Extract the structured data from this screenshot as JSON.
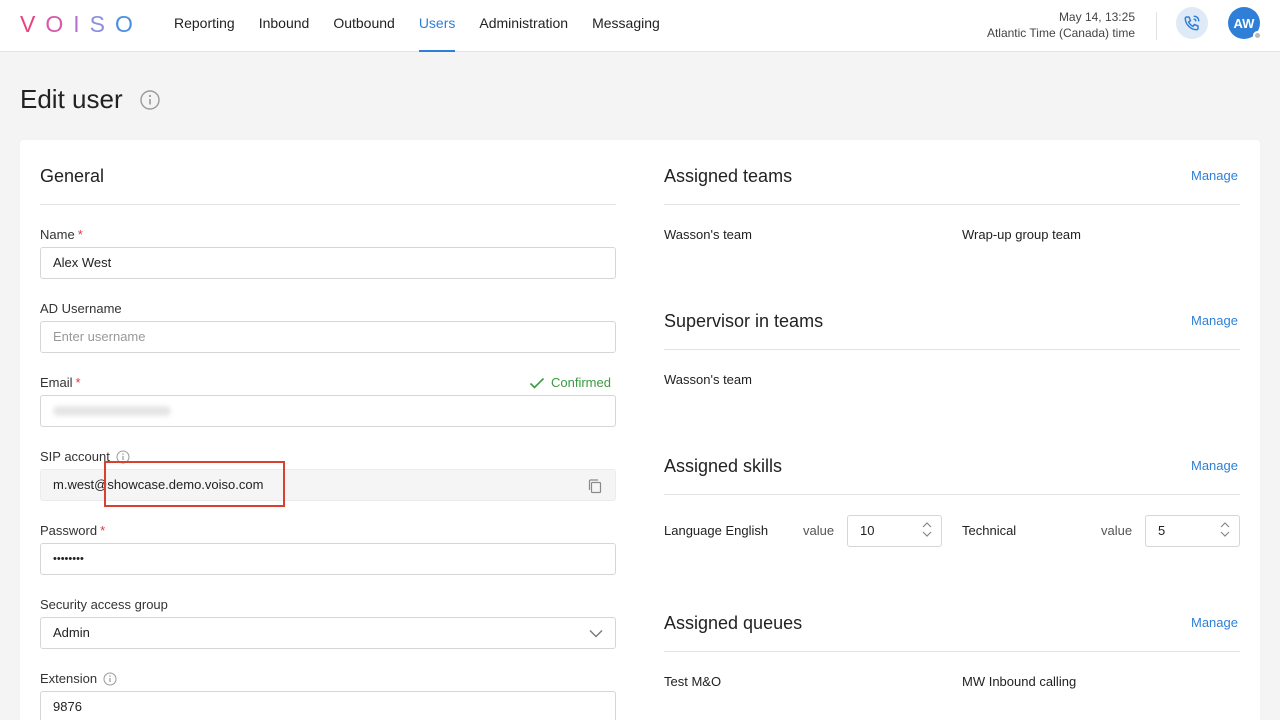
{
  "logo": {
    "letters": [
      "V",
      "O",
      "I",
      "S",
      "O"
    ],
    "colors": [
      "#e8457e",
      "#d65aa8",
      "#b274d0",
      "#8a8fe0",
      "#4b8fe0"
    ]
  },
  "nav": {
    "items": [
      "Reporting",
      "Inbound",
      "Outbound",
      "Users",
      "Administration",
      "Messaging"
    ],
    "active_index": 3
  },
  "header": {
    "date": "May 14, 13:25",
    "timezone": "Atlantic Time (Canada) time",
    "avatar_initials": "AW"
  },
  "page": {
    "title": "Edit user"
  },
  "general": {
    "title": "General",
    "name_label": "Name",
    "name_value": "Alex West",
    "ad_label": "AD Username",
    "ad_placeholder": "Enter username",
    "email_label": "Email",
    "email_status": "Confirmed",
    "sip_label": "SIP account",
    "sip_value": "m.west@showcase.demo.voiso.com",
    "password_label": "Password",
    "password_value": "••••••••",
    "security_label": "Security access group",
    "security_value": "Admin",
    "extension_label": "Extension",
    "extension_value": "9876",
    "required_mark": "*"
  },
  "assigned_teams": {
    "title": "Assigned teams",
    "manage": "Manage",
    "items": [
      "Wasson's team",
      "Wrap-up group team"
    ]
  },
  "supervisor_teams": {
    "title": "Supervisor in teams",
    "manage": "Manage",
    "items": [
      "Wasson's team"
    ]
  },
  "assigned_skills": {
    "title": "Assigned skills",
    "manage": "Manage",
    "value_label": "value",
    "skills": [
      {
        "name": "Language English",
        "value": "10"
      },
      {
        "name": "Technical",
        "value": "5"
      }
    ]
  },
  "assigned_queues": {
    "title": "Assigned queues",
    "manage": "Manage",
    "items": [
      "Test M&O",
      "MW Inbound calling"
    ]
  },
  "colors": {
    "accent": "#2f7fd8",
    "confirmed": "#3a9b3f",
    "required": "#e0393e",
    "highlight": "#d8402f"
  }
}
